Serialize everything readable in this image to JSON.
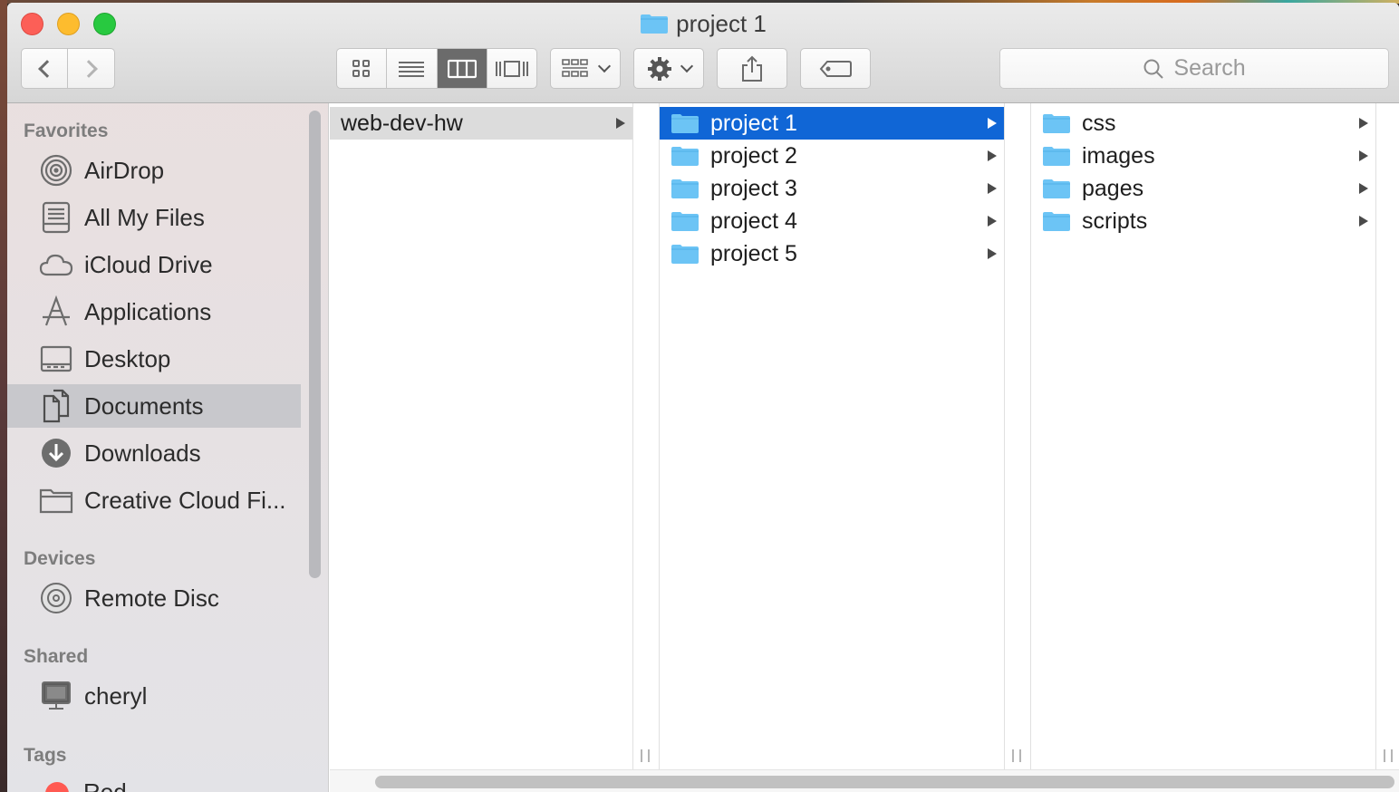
{
  "window": {
    "title": "project 1"
  },
  "toolbar": {
    "back_icon": "chevron-left-icon",
    "forward_icon": "chevron-right-icon",
    "view_modes": [
      "icon-view",
      "list-view",
      "column-view",
      "cover-flow-view"
    ],
    "active_view": "column-view",
    "arrange_icon": "arrange-grid-icon",
    "action_icon": "gear-icon",
    "share_icon": "share-icon",
    "tags_icon": "tag-icon",
    "search_placeholder": "Search"
  },
  "sidebar": {
    "favorites_header": "Favorites",
    "favorites": [
      {
        "label": "AirDrop",
        "icon": "airdrop-icon"
      },
      {
        "label": "All My Files",
        "icon": "all-files-icon"
      },
      {
        "label": "iCloud Drive",
        "icon": "cloud-icon"
      },
      {
        "label": "Applications",
        "icon": "applications-icon"
      },
      {
        "label": "Desktop",
        "icon": "desktop-icon"
      },
      {
        "label": "Documents",
        "icon": "documents-icon",
        "selected": true
      },
      {
        "label": "Downloads",
        "icon": "downloads-icon"
      },
      {
        "label": "Creative Cloud Fi...",
        "icon": "folder-icon"
      }
    ],
    "devices_header": "Devices",
    "devices": [
      {
        "label": "Remote Disc",
        "icon": "disc-icon"
      }
    ],
    "shared_header": "Shared",
    "shared": [
      {
        "label": "cheryl",
        "icon": "computer-icon"
      }
    ],
    "tags_header": "Tags",
    "tags": [
      {
        "label": "Red",
        "color": "#ff5a52"
      }
    ]
  },
  "columns": [
    {
      "items": [
        {
          "label": "web-dev-hw",
          "selected": "gray"
        }
      ]
    },
    {
      "items": [
        {
          "label": "project 1",
          "selected": "blue"
        },
        {
          "label": "project 2"
        },
        {
          "label": "project 3"
        },
        {
          "label": "project 4"
        },
        {
          "label": "project 5"
        }
      ]
    },
    {
      "items": [
        {
          "label": "css"
        },
        {
          "label": "images"
        },
        {
          "label": "pages"
        },
        {
          "label": "scripts"
        }
      ]
    }
  ],
  "colors": {
    "selection_blue": "#1066d6",
    "folder_blue": "#6cc4f5",
    "close": "#fc5f57",
    "minimize": "#fdbc2e",
    "maximize": "#28c940"
  }
}
